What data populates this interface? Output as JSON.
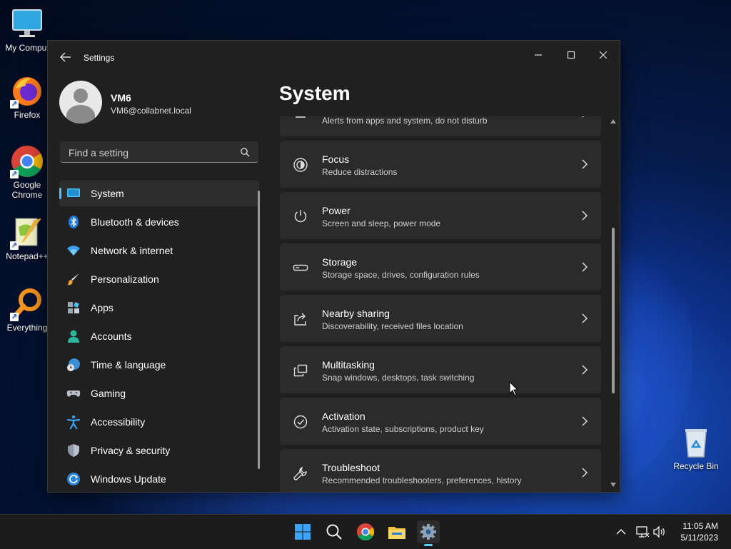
{
  "desktop": {
    "icons": [
      {
        "label": "My Comput",
        "icon": "monitor-icon"
      },
      {
        "label": "Firefox",
        "icon": "firefox-icon"
      },
      {
        "label": "Google Chrome",
        "icon": "chrome-icon"
      },
      {
        "label": "Notepad++",
        "icon": "notepad-plus-plus-icon"
      },
      {
        "label": "Everything",
        "icon": "everything-search-icon"
      },
      {
        "label": "Recycle Bin",
        "icon": "recycle-bin-icon"
      }
    ]
  },
  "window": {
    "title": "Settings",
    "back_icon": "back-arrow-icon",
    "controls": [
      "minimize-icon",
      "maximize-icon",
      "close-icon"
    ]
  },
  "profile": {
    "name": "VM6",
    "email": "VM6@collabnet.local"
  },
  "search": {
    "placeholder": "Find a setting",
    "value": ""
  },
  "nav": {
    "items": [
      {
        "label": "System",
        "icon": "system-icon",
        "active": true
      },
      {
        "label": "Bluetooth & devices",
        "icon": "bluetooth-icon"
      },
      {
        "label": "Network & internet",
        "icon": "wifi-icon"
      },
      {
        "label": "Personalization",
        "icon": "brush-icon"
      },
      {
        "label": "Apps",
        "icon": "apps-icon"
      },
      {
        "label": "Accounts",
        "icon": "accounts-icon"
      },
      {
        "label": "Time & language",
        "icon": "globe-clock-icon"
      },
      {
        "label": "Gaming",
        "icon": "gamepad-icon"
      },
      {
        "label": "Accessibility",
        "icon": "accessibility-icon"
      },
      {
        "label": "Privacy & security",
        "icon": "shield-icon"
      },
      {
        "label": "Windows Update",
        "icon": "update-icon"
      }
    ]
  },
  "main": {
    "title": "System",
    "cards": [
      {
        "title": "",
        "subtitle": "Alerts from apps and system, do not disturb",
        "icon": "notifications-icon"
      },
      {
        "title": "Focus",
        "subtitle": "Reduce distractions",
        "icon": "focus-icon"
      },
      {
        "title": "Power",
        "subtitle": "Screen and sleep, power mode",
        "icon": "power-icon"
      },
      {
        "title": "Storage",
        "subtitle": "Storage space, drives, configuration rules",
        "icon": "storage-icon"
      },
      {
        "title": "Nearby sharing",
        "subtitle": "Discoverability, received files location",
        "icon": "share-icon"
      },
      {
        "title": "Multitasking",
        "subtitle": "Snap windows, desktops, task switching",
        "icon": "multitasking-icon"
      },
      {
        "title": "Activation",
        "subtitle": "Activation state, subscriptions, product key",
        "icon": "activation-check-icon"
      },
      {
        "title": "Troubleshoot",
        "subtitle": "Recommended troubleshooters, preferences, history",
        "icon": "wrench-icon"
      }
    ]
  },
  "taskbar": {
    "apps": [
      "start-icon",
      "search-icon",
      "chrome-icon",
      "file-explorer-icon",
      "settings-gear-icon"
    ],
    "active_app": "settings-gear-icon",
    "tray": [
      "chevron-up-icon",
      "network-icon",
      "volume-icon"
    ],
    "time": "11:05 AM",
    "date": "5/11/2023"
  },
  "colors": {
    "accent": "#4cc2ff",
    "window_bg": "#202020",
    "card_bg": "#2b2b2b",
    "taskbar_bg": "#1c1c1c"
  }
}
